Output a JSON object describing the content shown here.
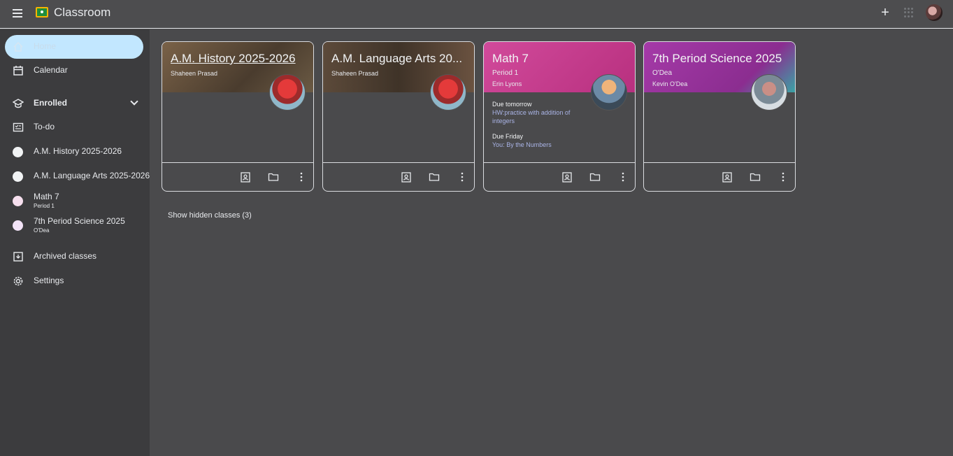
{
  "header": {
    "app_title": "Classroom",
    "menu_icon": "hamburger-menu-icon",
    "plus_icon": "+",
    "apps_icon": "apps-grid-icon"
  },
  "sidebar": {
    "home": "Home",
    "calendar": "Calendar",
    "enrolled": "Enrolled",
    "todo": "To-do",
    "classes": [
      {
        "name": "A.M. History 2025-2026",
        "sub": ""
      },
      {
        "name": "A.M. Language Arts 2025-2026",
        "sub": ""
      },
      {
        "name": "Math 7",
        "sub": "Period 1"
      },
      {
        "name": "7th Period Science 2025",
        "sub": "O'Dea"
      }
    ],
    "archived": "Archived classes",
    "settings": "Settings"
  },
  "cards": [
    {
      "title": "A.M. History 2025-2026",
      "teacher": "Shaheen Prasad",
      "banner": "#6b5a44"
    },
    {
      "title": "A.M. Language Arts 20...",
      "teacher": "Shaheen Prasad",
      "banner": "#5a4a3a"
    },
    {
      "title": "Math 7",
      "section": "Period 1",
      "teacher": "Erin Lyons",
      "banner": "#c2378b",
      "due": [
        {
          "label": "Due tomorrow",
          "item": "HW:practice with addition of integers"
        },
        {
          "label": "Due Friday",
          "item": "You: By the Numbers"
        }
      ]
    },
    {
      "title": "7th Period Science 2025",
      "section": "O'Dea",
      "teacher": "Kevin O'Dea",
      "banner": "#9a2f9e"
    }
  ],
  "hidden_classes": "Show hidden classes (3)",
  "colors": {
    "accent_active": "#c2e7ff",
    "link": "#aab4e6"
  }
}
